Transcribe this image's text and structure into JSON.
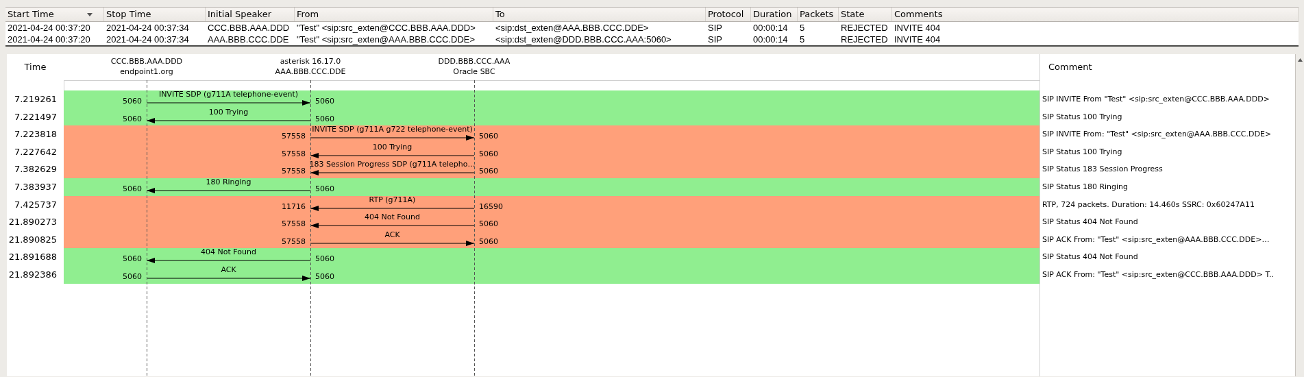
{
  "table": {
    "columns": [
      {
        "label": "Start Time",
        "sorted": true
      },
      {
        "label": "Stop Time",
        "sorted": false
      },
      {
        "label": "Initial Speaker",
        "sorted": false
      },
      {
        "label": "From",
        "sorted": false
      },
      {
        "label": "To",
        "sorted": false
      },
      {
        "label": "Protocol",
        "sorted": false
      },
      {
        "label": "Duration",
        "sorted": false
      },
      {
        "label": "Packets",
        "sorted": false
      },
      {
        "label": "State",
        "sorted": false
      },
      {
        "label": "Comments",
        "sorted": false
      }
    ],
    "rows": [
      [
        "2021-04-24 00:37:20",
        "2021-04-24 00:37:34",
        "CCC.BBB.AAA.DDD",
        "\"Test\" <sip:src_exten@CCC.BBB.AAA.DDD>",
        "<sip:dst_exten@AAA.BBB.CCC.DDE>",
        "SIP",
        "00:00:14",
        "5",
        "REJECTED",
        "INVITE 404"
      ],
      [
        "2021-04-24 00:37:20",
        "2021-04-24 00:37:34",
        "AAA.BBB.CCC.DDE",
        "\"Test\" <sip:src_exten@AAA.BBB.CCC.DDE>",
        "<sip:dst_exten@DDD.BBB.CCC.AAA:5060>",
        "SIP",
        "00:00:14",
        "5",
        "REJECTED",
        "INVITE 404"
      ]
    ]
  },
  "diagram": {
    "time_header": "Time",
    "comment_header": "Comment",
    "nodes": [
      {
        "lines": [
          "CCC.BBB.AAA.DDD",
          "endpoint1.org"
        ]
      },
      {
        "lines": [
          "asterisk 16.17.0",
          "AAA.BBB.CCC.DDE"
        ]
      },
      {
        "lines": [
          "DDD.BBB.CCC.AAA",
          "Oracle SBC"
        ]
      }
    ],
    "messages": [
      {
        "time": "7.219261",
        "color": "#90ee90",
        "kind": "first_leg",
        "rightward": true,
        "left_port": "5060",
        "right_port": "5060",
        "label": "INVITE SDP (g711A telephone-event)",
        "comment": "SIP INVITE From  \"Test\" <sip:src_exten@CCC.BBB.AAA.DDD>"
      },
      {
        "time": "7.221497",
        "color": "#90ee90",
        "kind": "first_leg",
        "rightward": false,
        "left_port": "5060",
        "right_port": "5060",
        "label": "100 Trying",
        "comment": "SIP Status 100 Trying"
      },
      {
        "time": "7.223818",
        "color": "#ffa07a",
        "kind": "second_leg",
        "rightward": true,
        "left_port": "57558",
        "right_port": "5060",
        "label": "INVITE SDP (g711A g722 telephone-event)",
        "comment": "SIP INVITE From: \"Test\" <sip:src_exten@AAA.BBB.CCC.DDE>"
      },
      {
        "time": "7.227642",
        "color": "#ffa07a",
        "kind": "second_leg",
        "rightward": false,
        "left_port": "57558",
        "right_port": "5060",
        "label": "100 Trying",
        "comment": "SIP Status 100 Trying"
      },
      {
        "time": "7.382629",
        "color": "#ffa07a",
        "kind": "second_leg",
        "rightward": false,
        "left_port": "57558",
        "right_port": "5060",
        "label": "183 Session Progress SDP (g711A telepho…",
        "comment": "SIP Status 183 Session Progress"
      },
      {
        "time": "7.383937",
        "color": "#90ee90",
        "kind": "first_leg",
        "rightward": false,
        "left_port": "5060",
        "right_port": "5060",
        "label": "180 Ringing",
        "comment": "SIP Status 180 Ringing"
      },
      {
        "time": "7.425737",
        "color": "#ffa07a",
        "kind": "second_leg",
        "rightward": false,
        "left_port": "11716",
        "right_port": "16590",
        "label": "RTP (g711A)",
        "comment": "RTP, 724 packets. Duration: 14.460s SSRC: 0x60247A11"
      },
      {
        "time": "21.890273",
        "color": "#ffa07a",
        "kind": "second_leg",
        "rightward": false,
        "left_port": "57558",
        "right_port": "5060",
        "label": "404 Not Found",
        "comment": "SIP Status 404 Not Found"
      },
      {
        "time": "21.890825",
        "color": "#ffa07a",
        "kind": "second_leg",
        "rightward": true,
        "left_port": "57558",
        "right_port": "5060",
        "label": "ACK",
        "comment": "SIP ACK From: \"Test\" <sip:src_exten@AAA.BBB.CCC.DDE>…"
      },
      {
        "time": "21.891688",
        "color": "#90ee90",
        "kind": "first_leg",
        "rightward": false,
        "left_port": "5060",
        "right_port": "5060",
        "label": "404 Not Found",
        "comment": "SIP Status 404 Not Found"
      },
      {
        "time": "21.892386",
        "color": "#90ee90",
        "kind": "first_leg",
        "rightward": true,
        "left_port": "5060",
        "right_port": "5060",
        "label": "ACK",
        "comment": "SIP ACK From: \"Test\" <sip:src_exten@CCC.BBB.AAA.DDD> T.."
      }
    ]
  }
}
